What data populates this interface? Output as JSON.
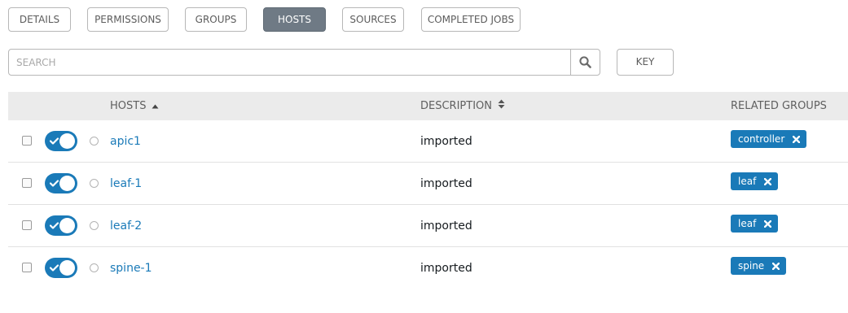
{
  "tabs": [
    {
      "label": "DETAILS",
      "active": false
    },
    {
      "label": "PERMISSIONS",
      "active": false
    },
    {
      "label": "GROUPS",
      "active": false
    },
    {
      "label": "HOSTS",
      "active": true
    },
    {
      "label": "SOURCES",
      "active": false
    },
    {
      "label": "COMPLETED JOBS",
      "active": false
    }
  ],
  "search": {
    "placeholder": "SEARCH",
    "value": "",
    "icon": "search-icon"
  },
  "key_button": {
    "label": "KEY"
  },
  "table": {
    "columns": {
      "hosts": {
        "label": "HOSTS",
        "sort": "ascending"
      },
      "description": {
        "label": "DESCRIPTION",
        "sort": "sortable"
      },
      "related_groups": {
        "label": "RELATED GROUPS"
      }
    },
    "rows": [
      {
        "name": "apic1",
        "description": "imported",
        "enabled": true,
        "selected": false,
        "groups": [
          "controller"
        ]
      },
      {
        "name": "leaf-1",
        "description": "imported",
        "enabled": true,
        "selected": false,
        "groups": [
          "leaf"
        ]
      },
      {
        "name": "leaf-2",
        "description": "imported",
        "enabled": true,
        "selected": false,
        "groups": [
          "leaf"
        ]
      },
      {
        "name": "spine-1",
        "description": "imported",
        "enabled": true,
        "selected": false,
        "groups": [
          "spine"
        ]
      }
    ]
  },
  "colors": {
    "accent": "#1a7ab8",
    "active_tab": "#6f7a85",
    "header_bg": "#ebebeb",
    "link": "#1a7ab8"
  }
}
